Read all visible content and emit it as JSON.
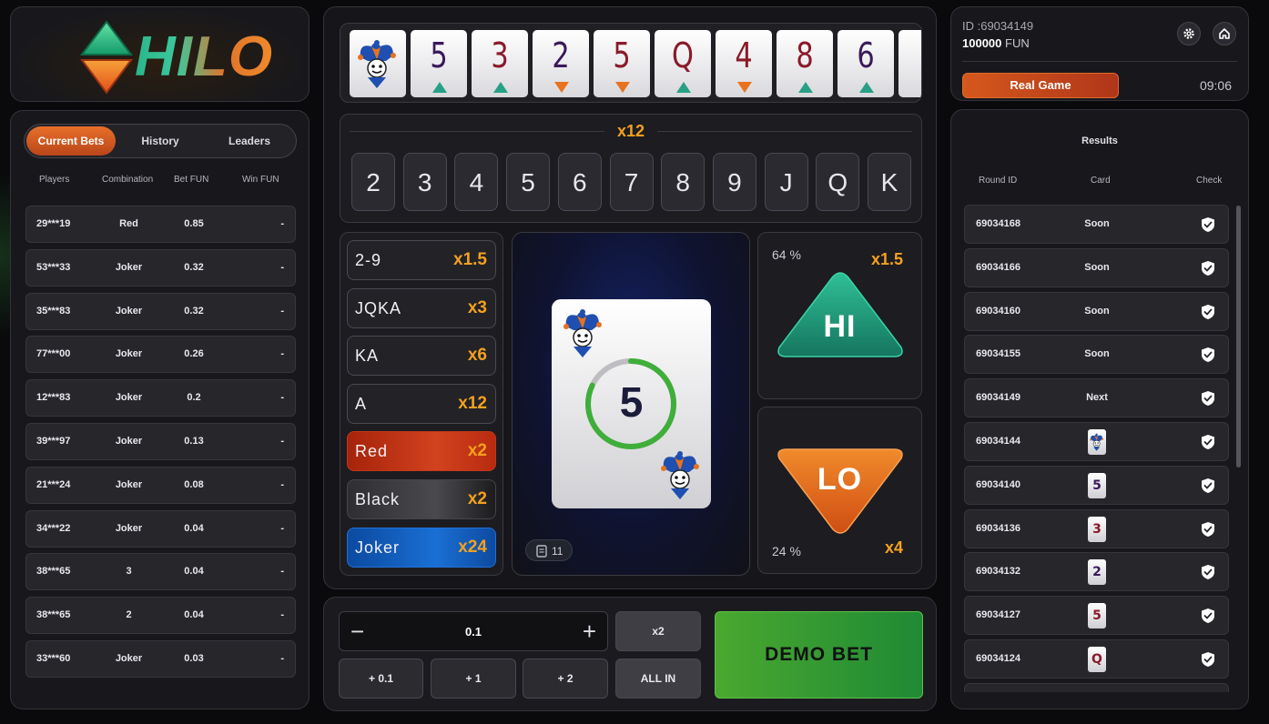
{
  "logo": {
    "text": "HILO"
  },
  "tabs": [
    {
      "label": "Current Bets",
      "active": true
    },
    {
      "label": "History",
      "active": false
    },
    {
      "label": "Leaders",
      "active": false
    }
  ],
  "bets": {
    "columns": [
      "Players",
      "Combination",
      "Bet FUN",
      "Win FUN"
    ],
    "rows": [
      {
        "player": "29***19",
        "combination": "Red",
        "bet": "0.85",
        "win": "-"
      },
      {
        "player": "53***33",
        "combination": "Joker",
        "bet": "0.32",
        "win": "-"
      },
      {
        "player": "35***83",
        "combination": "Joker",
        "bet": "0.32",
        "win": "-"
      },
      {
        "player": "77***00",
        "combination": "Joker",
        "bet": "0.26",
        "win": "-"
      },
      {
        "player": "12***83",
        "combination": "Joker",
        "bet": "0.2",
        "win": "-"
      },
      {
        "player": "39***97",
        "combination": "Joker",
        "bet": "0.13",
        "win": "-"
      },
      {
        "player": "21***24",
        "combination": "Joker",
        "bet": "0.08",
        "win": "-"
      },
      {
        "player": "34***22",
        "combination": "Joker",
        "bet": "0.04",
        "win": "-"
      },
      {
        "player": "38***65",
        "combination": "3",
        "bet": "0.04",
        "win": "-"
      },
      {
        "player": "38***65",
        "combination": "2",
        "bet": "0.04",
        "win": "-"
      },
      {
        "player": "33***60",
        "combination": "Joker",
        "bet": "0.03",
        "win": "-"
      }
    ]
  },
  "history_strip": [
    {
      "rank": "joker",
      "dir": "none",
      "color": "#7a1f5a"
    },
    {
      "rank": "5",
      "dir": "up",
      "color": "#3a1a5a"
    },
    {
      "rank": "3",
      "dir": "up",
      "color": "#8a1a2a"
    },
    {
      "rank": "2",
      "dir": "down",
      "color": "#3a1a5a"
    },
    {
      "rank": "5",
      "dir": "down",
      "color": "#8a1a2a"
    },
    {
      "rank": "Q",
      "dir": "up",
      "color": "#8a1a2a"
    },
    {
      "rank": "4",
      "dir": "down",
      "color": "#8a1a2a"
    },
    {
      "rank": "8",
      "dir": "up",
      "color": "#8a1a2a"
    },
    {
      "rank": "6",
      "dir": "up",
      "color": "#3a1a5a"
    }
  ],
  "rank_bet": {
    "multiplier": "x12",
    "ranks": [
      "2",
      "3",
      "4",
      "5",
      "6",
      "7",
      "8",
      "9",
      "J",
      "Q",
      "K"
    ]
  },
  "combos": [
    {
      "label": "2-9",
      "mult": "x1.5",
      "style": "plain"
    },
    {
      "label": "JQKA",
      "mult": "x3",
      "style": "plain"
    },
    {
      "label": "KA",
      "mult": "x6",
      "style": "plain"
    },
    {
      "label": "A",
      "mult": "x12",
      "style": "plain"
    },
    {
      "label": "Red",
      "mult": "x2",
      "style": "red"
    },
    {
      "label": "Black",
      "mult": "x2",
      "style": "black"
    },
    {
      "label": "Joker",
      "mult": "x24",
      "style": "blue"
    }
  ],
  "current_card": {
    "rank": "5",
    "timer_fraction": 0.82,
    "deck_count": "11"
  },
  "hi": {
    "label": "HI",
    "percent": "64 %",
    "mult": "x1.5"
  },
  "lo": {
    "label": "LO",
    "percent": "24 %",
    "mult": "x4"
  },
  "controls": {
    "minus": "−",
    "plus": "+",
    "amount": "0.1",
    "double": "x2",
    "add_01": "+ 0.1",
    "add_1": "+ 1",
    "add_2": "+ 2",
    "all_in": "ALL IN",
    "demo_bet": "DEMO BET"
  },
  "account": {
    "id": "ID :69034149",
    "balance": "100000",
    "currency": "FUN",
    "real_game": "Real Game",
    "time": "09:06"
  },
  "results": {
    "title": "Results",
    "columns": [
      "Round ID",
      "Card",
      "Check"
    ],
    "rows": [
      {
        "round": "69034168",
        "card": "Soon"
      },
      {
        "round": "69034166",
        "card": "Soon"
      },
      {
        "round": "69034160",
        "card": "Soon"
      },
      {
        "round": "69034155",
        "card": "Soon"
      },
      {
        "round": "69034149",
        "card": "Next"
      },
      {
        "round": "69034144",
        "card": "",
        "mini": "joker"
      },
      {
        "round": "69034140",
        "card": "",
        "mini": "5",
        "color": "#3a1a5a"
      },
      {
        "round": "69034136",
        "card": "",
        "mini": "3",
        "color": "#8a1a2a"
      },
      {
        "round": "69034132",
        "card": "",
        "mini": "2",
        "color": "#3a1a5a"
      },
      {
        "round": "69034127",
        "card": "",
        "mini": "5",
        "color": "#8a1a2a"
      },
      {
        "round": "69034124",
        "card": "",
        "mini": "Q",
        "color": "#8a1a2a"
      }
    ]
  },
  "colors": {
    "accent_orange": "#f3a11e",
    "hi_green": "#27a085",
    "lo_orange": "#e8721e",
    "demo_green": "#3a9c32"
  }
}
